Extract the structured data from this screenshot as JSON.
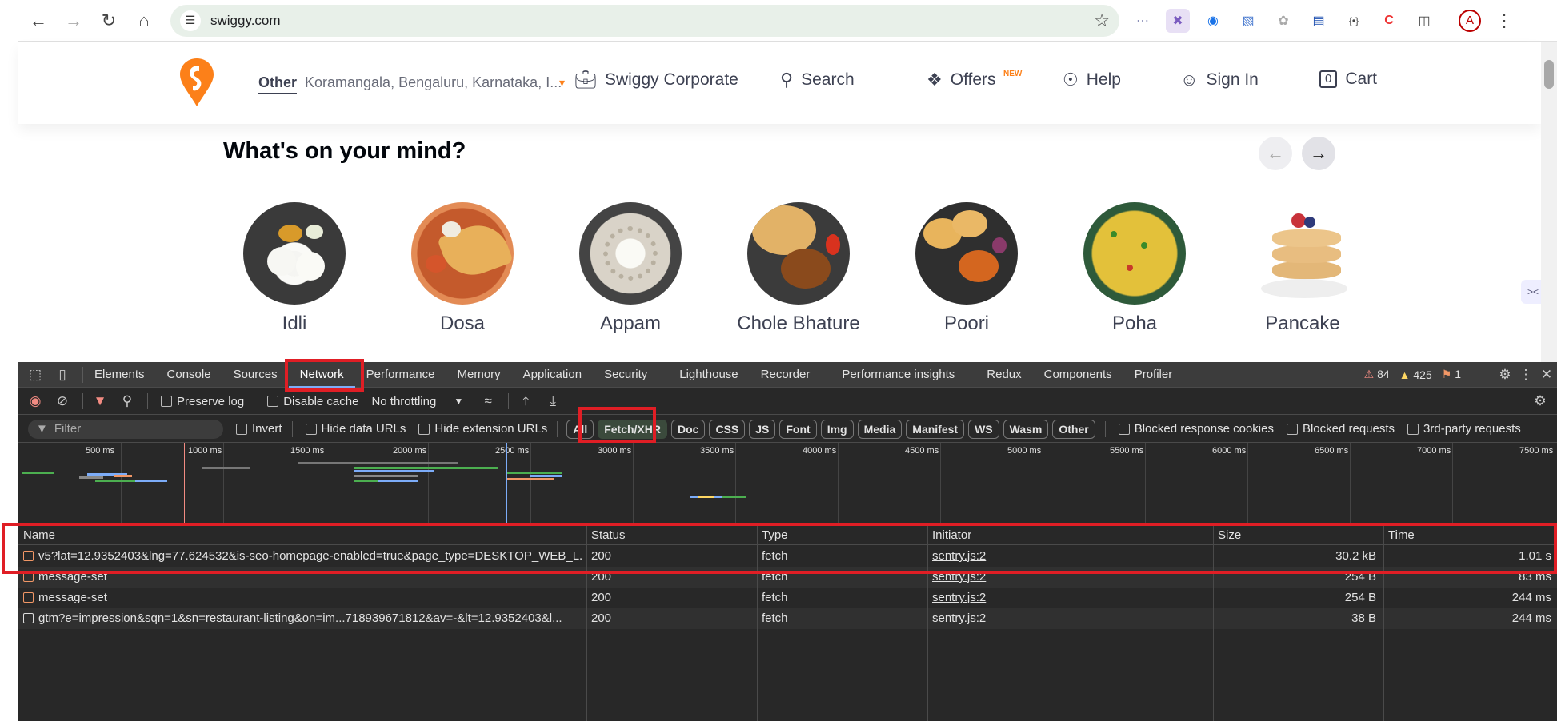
{
  "browser": {
    "url": "swiggy.com",
    "nav": [
      "back-icon",
      "forward-icon",
      "reload-icon",
      "home-icon"
    ],
    "extensions": [
      "ext-1",
      "ext-2",
      "ext-3",
      "ext-4",
      "ext-5",
      "ext-6",
      "ext-7",
      "ext-8",
      "puzzle-icon"
    ],
    "profile_initial": "A"
  },
  "site": {
    "location_label": "Other",
    "location_value": "Koramangala, Bengaluru, Karnataka, I...",
    "nav": {
      "corporate": "Swiggy Corporate",
      "search": "Search",
      "offers": "Offers",
      "offers_badge": "NEW",
      "help": "Help",
      "signin": "Sign In",
      "cart_count": "0",
      "cart": "Cart"
    },
    "section_title": "What's on your mind?",
    "foods": [
      {
        "label": "Idli"
      },
      {
        "label": "Dosa"
      },
      {
        "label": "Appam"
      },
      {
        "label": "Chole Bhature"
      },
      {
        "label": "Poori"
      },
      {
        "label": "Poha"
      },
      {
        "label": "Pancake"
      }
    ]
  },
  "devtools": {
    "tabs": [
      "Elements",
      "Console",
      "Sources",
      "Network",
      "Performance",
      "Memory",
      "Application",
      "Security",
      "Lighthouse",
      "Recorder",
      "Performance insights",
      "Redux",
      "Components",
      "Profiler"
    ],
    "active_tab": "Network",
    "errors": "84",
    "warnings": "425",
    "issues": "1",
    "toolbar": {
      "preserve_log": "Preserve log",
      "disable_cache": "Disable cache",
      "throttling": "No throttling"
    },
    "filterbar": {
      "placeholder": "Filter",
      "invert": "Invert",
      "hide_data": "Hide data URLs",
      "hide_ext": "Hide extension URLs",
      "chips": [
        "All",
        "Fetch/XHR",
        "Doc",
        "CSS",
        "JS",
        "Font",
        "Img",
        "Media",
        "Manifest",
        "WS",
        "Wasm",
        "Other"
      ],
      "active_chip": "Fetch/XHR",
      "blocked_cookies": "Blocked response cookies",
      "blocked_requests": "Blocked requests",
      "third_party": "3rd-party requests"
    },
    "timeline_ticks": [
      "500 ms",
      "1000 ms",
      "1500 ms",
      "2000 ms",
      "2500 ms",
      "3000 ms",
      "3500 ms",
      "4000 ms",
      "4500 ms",
      "5000 ms",
      "5500 ms",
      "6000 ms",
      "6500 ms",
      "7000 ms",
      "7500 ms"
    ],
    "columns": [
      "Name",
      "Status",
      "Type",
      "Initiator",
      "Size",
      "Time"
    ],
    "rows": [
      {
        "name": "v5?lat=12.9352403&lng=77.624532&is-seo-homepage-enabled=true&page_type=DESKTOP_WEB_L...",
        "status": "200",
        "type": "fetch",
        "initiator": "sentry.js:2",
        "size": "30.2 kB",
        "time": "1.01 s",
        "icon": "xhr"
      },
      {
        "name": "message-set",
        "status": "200",
        "type": "fetch",
        "initiator": "sentry.js:2",
        "size": "254 B",
        "time": "83 ms",
        "icon": "xhr"
      },
      {
        "name": "message-set",
        "status": "200",
        "type": "fetch",
        "initiator": "sentry.js:2",
        "size": "254 B",
        "time": "244 ms",
        "icon": "xhr"
      },
      {
        "name": "gtm?e=impression&sqn=1&sn=restaurant-listing&on=im...718939671812&av=-&lt=12.9352403&l...",
        "status": "200",
        "type": "fetch",
        "initiator": "sentry.js:2",
        "size": "38 B",
        "time": "244 ms",
        "icon": "doc"
      }
    ]
  }
}
